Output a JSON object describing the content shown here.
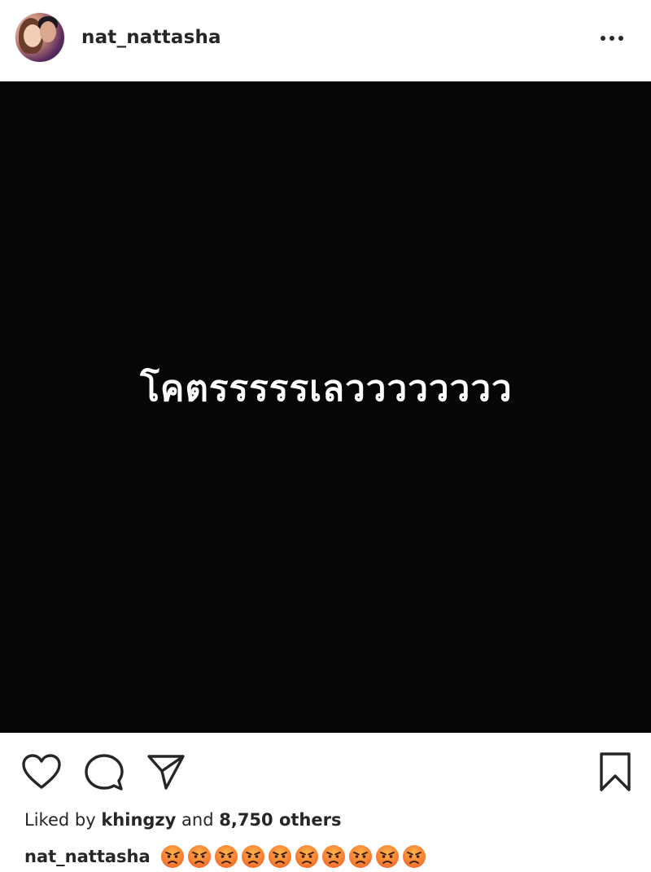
{
  "header": {
    "username": "nat_nattasha",
    "avatar": "profile-avatar",
    "more_icon": "more-horizontal-icon"
  },
  "post": {
    "image_text": "โคตรรรรรเลวววววววว",
    "background_color": "#060606"
  },
  "actions": {
    "icons": [
      "heart-icon",
      "comment-icon",
      "share-icon",
      "bookmark-icon"
    ]
  },
  "likes": {
    "prefix": "Liked by",
    "user": "khingzy",
    "conjunction": "and",
    "count_text": "8,750 others"
  },
  "caption": {
    "username": "nat_nattasha",
    "emoji": "😡",
    "emoji_count": 10,
    "emoji_color": "#f26b2b"
  }
}
